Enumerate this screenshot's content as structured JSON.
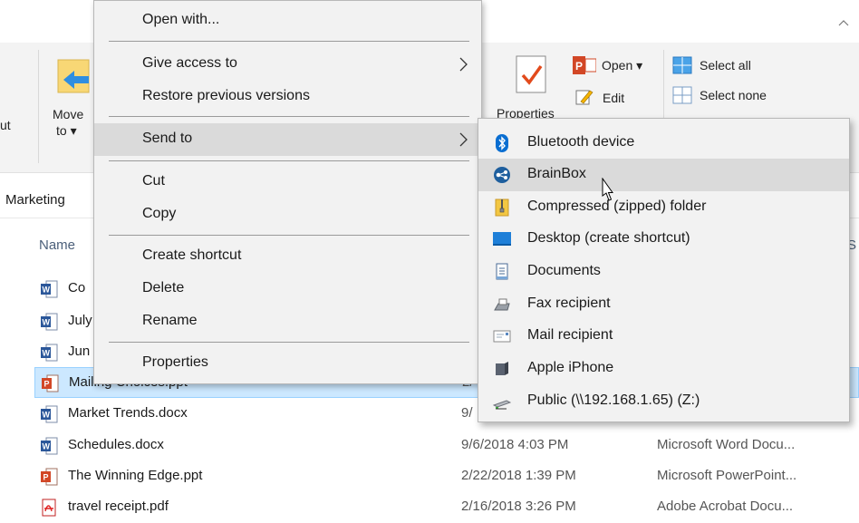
{
  "ribbon": {
    "cut_fragment": "ut",
    "move_to_line1": "Move",
    "move_to_line2": "to",
    "properties_label": "Properties",
    "open_label": "Open",
    "edit_label": "Edit",
    "select_all_label": "Select all",
    "select_none_label": "Select none"
  },
  "address": {
    "path": "Marketing"
  },
  "columns": {
    "name": "Name",
    "size_fragment": "S"
  },
  "files": [
    {
      "name": "Co",
      "date": "",
      "type": "",
      "icon": "word-doc-icon"
    },
    {
      "name": "July",
      "date": "",
      "type": "",
      "icon": "word-doc-icon"
    },
    {
      "name": "Jun",
      "date": "",
      "type": "",
      "icon": "word-doc-icon"
    },
    {
      "name": "Mailing Choices.ppt",
      "date": "2/",
      "type": "",
      "icon": "powerpoint-icon"
    },
    {
      "name": "Market Trends.docx",
      "date": "9/",
      "type": "",
      "icon": "word-doc-icon"
    },
    {
      "name": "Schedules.docx",
      "date": "9/6/2018 4:03 PM",
      "type": "Microsoft Word Docu...",
      "icon": "word-doc-icon"
    },
    {
      "name": "The Winning Edge.ppt",
      "date": "2/22/2018 1:39 PM",
      "type": "Microsoft PowerPoint...",
      "icon": "powerpoint-icon"
    },
    {
      "name": "travel receipt.pdf",
      "date": "2/16/2018 3:26 PM",
      "type": "Adobe Acrobat Docu...",
      "icon": "pdf-icon"
    }
  ],
  "context_menu": {
    "items": [
      {
        "label": "Open with..."
      },
      {
        "label": "Give access to",
        "submenu": true
      },
      {
        "label": "Restore previous versions"
      },
      {
        "label": "Send to",
        "submenu": true,
        "highlighted": true
      },
      {
        "label": "Cut"
      },
      {
        "label": "Copy"
      },
      {
        "label": "Create shortcut"
      },
      {
        "label": "Delete"
      },
      {
        "label": "Rename"
      },
      {
        "label": "Properties"
      }
    ]
  },
  "send_to_menu": {
    "items": [
      {
        "label": "Bluetooth device",
        "icon": "bluetooth-icon"
      },
      {
        "label": "BrainBox",
        "icon": "brainbox-icon",
        "highlighted": true
      },
      {
        "label": "Compressed (zipped) folder",
        "icon": "zip-folder-icon"
      },
      {
        "label": "Desktop (create shortcut)",
        "icon": "desktop-icon"
      },
      {
        "label": "Documents",
        "icon": "documents-icon"
      },
      {
        "label": "Fax recipient",
        "icon": "fax-icon"
      },
      {
        "label": "Mail recipient",
        "icon": "mail-icon"
      },
      {
        "label": "Apple iPhone",
        "icon": "iphone-icon"
      },
      {
        "label": "Public (\\\\192.168.1.65) (Z:)",
        "icon": "network-drive-icon"
      }
    ]
  },
  "colors": {
    "selection_bg": "#cce8ff",
    "menu_bg": "#f2f2f2",
    "menu_highlight": "#dadada",
    "bluetooth_blue": "#0a6ed1",
    "word_blue": "#2b579a",
    "powerpoint_red": "#d24726",
    "pdf_red": "#e02020"
  }
}
